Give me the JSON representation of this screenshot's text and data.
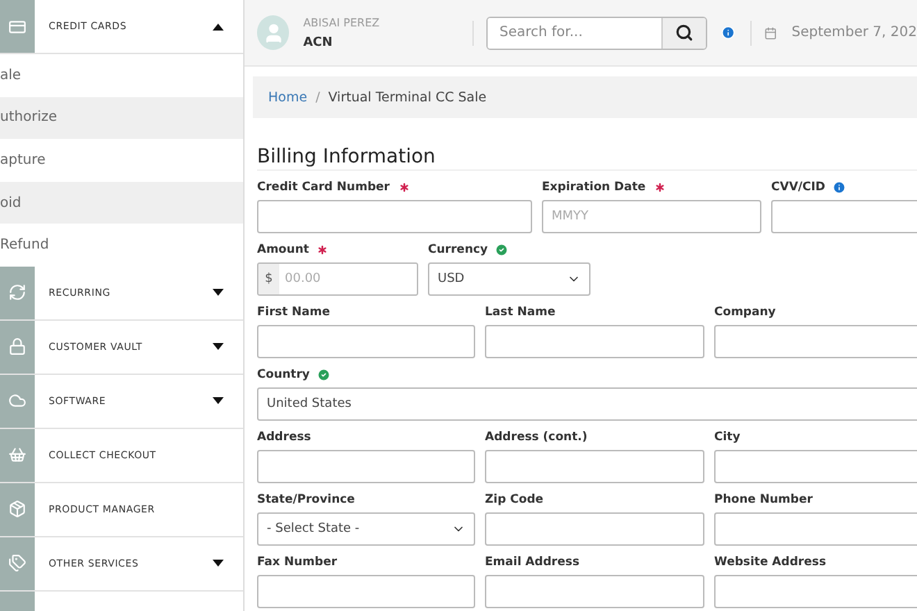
{
  "sidebar": {
    "items": [
      {
        "kind": "group",
        "label": "CREDIT CARDS",
        "expanded": true,
        "children": [
          {
            "label": "ale",
            "selected": false
          },
          {
            "label": "uthorize",
            "selected": false
          },
          {
            "label": "apture",
            "selected": false
          },
          {
            "label": "oid",
            "selected": false
          },
          {
            "label": "Refund",
            "selected": false
          }
        ]
      },
      {
        "kind": "group",
        "label": "RECURRING",
        "expanded": false
      },
      {
        "kind": "group",
        "label": "CUSTOMER VAULT",
        "expanded": false
      },
      {
        "kind": "group",
        "label": "SOFTWARE",
        "expanded": false
      },
      {
        "kind": "link",
        "label": "COLLECT CHECKOUT"
      },
      {
        "kind": "link",
        "label": "PRODUCT MANAGER"
      },
      {
        "kind": "group",
        "label": "OTHER SERVICES",
        "expanded": false
      }
    ]
  },
  "header": {
    "user_name": "ABISAI PEREZ",
    "company": "ACN",
    "search": {
      "placeholder": "Search for..."
    },
    "date": "September 7, 202"
  },
  "breadcrumb": {
    "items": [
      "Home",
      "Virtual Terminal CC Sale"
    ],
    "separator": "/"
  },
  "form": {
    "title": "Billing Information",
    "rows": [
      {
        "fields": [
          {
            "kind": "text",
            "label": "Credit Card Number",
            "required": true,
            "info": false,
            "valid": false
          },
          {
            "kind": "text",
            "label": "Expiration Date",
            "required": true,
            "info": false,
            "valid": false,
            "placeholder": "MMYY"
          },
          {
            "kind": "text",
            "label": "CVV/CID",
            "required": false,
            "info": true,
            "valid": false
          }
        ]
      },
      {
        "fields": [
          {
            "kind": "money",
            "label": "Amount",
            "required": true,
            "info": false,
            "valid": false,
            "prefix": "$",
            "placeholder": "00.00"
          },
          {
            "kind": "select",
            "label": "Currency",
            "required": false,
            "info": false,
            "valid": true,
            "value": "USD"
          }
        ]
      },
      {
        "fields": [
          {
            "kind": "text",
            "label": "First Name",
            "required": false,
            "info": false,
            "valid": false
          },
          {
            "kind": "text",
            "label": "Last Name",
            "required": false,
            "info": false,
            "valid": false
          },
          {
            "kind": "text",
            "label": "Company",
            "required": false,
            "info": false,
            "valid": false
          }
        ]
      },
      {
        "fields": [
          {
            "kind": "text",
            "label": "Country",
            "required": false,
            "info": false,
            "valid": true,
            "value": "United States"
          }
        ]
      },
      {
        "fields": [
          {
            "kind": "text",
            "label": "Address",
            "required": false,
            "info": false,
            "valid": false
          },
          {
            "kind": "text",
            "label": "Address (cont.)",
            "required": false,
            "info": false,
            "valid": false
          },
          {
            "kind": "text",
            "label": "City",
            "required": false,
            "info": false,
            "valid": false
          }
        ]
      },
      {
        "fields": [
          {
            "kind": "select",
            "label": "State/Province",
            "required": false,
            "info": false,
            "valid": false,
            "value": "- Select State -"
          },
          {
            "kind": "text",
            "label": "Zip Code",
            "required": false,
            "info": false,
            "valid": false
          },
          {
            "kind": "text",
            "label": "Phone Number",
            "required": false,
            "info": false,
            "valid": false
          }
        ]
      },
      {
        "fields": [
          {
            "kind": "text",
            "label": "Fax Number",
            "required": false,
            "info": false,
            "valid": false
          },
          {
            "kind": "text",
            "label": "Email Address",
            "required": false,
            "info": false,
            "valid": false
          },
          {
            "kind": "text",
            "label": "Website Address",
            "required": false,
            "info": false,
            "valid": false
          }
        ]
      }
    ]
  }
}
